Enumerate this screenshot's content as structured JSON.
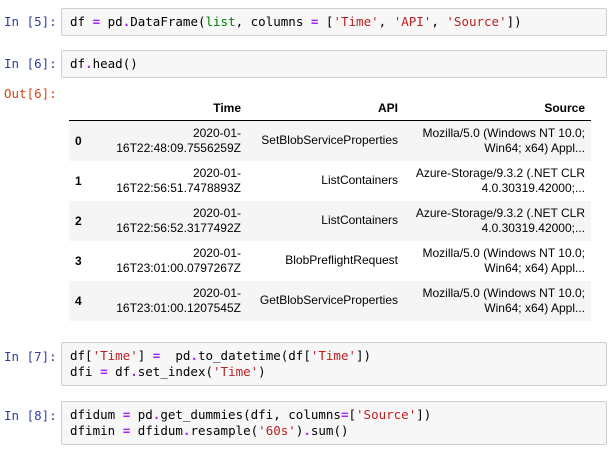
{
  "cells": [
    {
      "prompt": "In [5]:",
      "lines": [
        [
          {
            "t": "df",
            "c": "var"
          },
          {
            "t": " ",
            "c": "var"
          },
          {
            "t": "=",
            "c": "op"
          },
          {
            "t": " pd",
            "c": "var"
          },
          {
            "t": ".",
            "c": "op"
          },
          {
            "t": "DataFrame(",
            "c": "var"
          },
          {
            "t": "list",
            "c": "builtin"
          },
          {
            "t": ", columns ",
            "c": "var"
          },
          {
            "t": "=",
            "c": "op"
          },
          {
            "t": " [",
            "c": "var"
          },
          {
            "t": "'Time'",
            "c": "str"
          },
          {
            "t": ", ",
            "c": "var"
          },
          {
            "t": "'API'",
            "c": "str"
          },
          {
            "t": ", ",
            "c": "var"
          },
          {
            "t": "'Source'",
            "c": "str"
          },
          {
            "t": "])",
            "c": "var"
          }
        ]
      ]
    },
    {
      "prompt": "In [6]:",
      "lines": [
        [
          {
            "t": "df",
            "c": "var"
          },
          {
            "t": ".",
            "c": "op"
          },
          {
            "t": "head()",
            "c": "var"
          }
        ]
      ]
    },
    {
      "prompt": "In [7]:",
      "lines": [
        [
          {
            "t": "df[",
            "c": "var"
          },
          {
            "t": "'Time'",
            "c": "str"
          },
          {
            "t": "] ",
            "c": "var"
          },
          {
            "t": "=",
            "c": "op"
          },
          {
            "t": "  pd",
            "c": "var"
          },
          {
            "t": ".",
            "c": "op"
          },
          {
            "t": "to_datetime(df[",
            "c": "var"
          },
          {
            "t": "'Time'",
            "c": "str"
          },
          {
            "t": "])",
            "c": "var"
          }
        ],
        [
          {
            "t": "dfi ",
            "c": "var"
          },
          {
            "t": "=",
            "c": "op"
          },
          {
            "t": " df",
            "c": "var"
          },
          {
            "t": ".",
            "c": "op"
          },
          {
            "t": "set_index(",
            "c": "var"
          },
          {
            "t": "'Time'",
            "c": "str"
          },
          {
            "t": ")",
            "c": "var"
          }
        ]
      ]
    },
    {
      "prompt": "In [8]:",
      "lines": [
        [
          {
            "t": "dfidum ",
            "c": "var"
          },
          {
            "t": "=",
            "c": "op"
          },
          {
            "t": " pd",
            "c": "var"
          },
          {
            "t": ".",
            "c": "op"
          },
          {
            "t": "get_dummies(dfi, columns",
            "c": "var"
          },
          {
            "t": "=",
            "c": "op"
          },
          {
            "t": "[",
            "c": "var"
          },
          {
            "t": "'Source'",
            "c": "str"
          },
          {
            "t": "])",
            "c": "var"
          }
        ],
        [
          {
            "t": "dfimin ",
            "c": "var"
          },
          {
            "t": "=",
            "c": "op"
          },
          {
            "t": " dfidum",
            "c": "var"
          },
          {
            "t": ".",
            "c": "op"
          },
          {
            "t": "resample(",
            "c": "var"
          },
          {
            "t": "'60s'",
            "c": "str"
          },
          {
            "t": ")",
            "c": "var"
          },
          {
            "t": ".",
            "c": "op"
          },
          {
            "t": "sum()",
            "c": "var"
          }
        ]
      ]
    }
  ],
  "output_prompt": "Out[6]:",
  "table": {
    "columns": [
      "Time",
      "API",
      "Source"
    ],
    "rows": [
      {
        "index": "0",
        "time": [
          "2020-01-",
          "16T22:48:09.7556259Z"
        ],
        "api": "SetBlobServiceProperties",
        "source": [
          "Mozilla/5.0 (Windows NT 10.0;",
          "Win64; x64) Appl..."
        ]
      },
      {
        "index": "1",
        "time": [
          "2020-01-",
          "16T22:56:51.7478893Z"
        ],
        "api": "ListContainers",
        "source": [
          "Azure-Storage/9.3.2 (.NET CLR",
          "4.0.30319.42000;..."
        ]
      },
      {
        "index": "2",
        "time": [
          "2020-01-",
          "16T22:56:52.3177492Z"
        ],
        "api": "ListContainers",
        "source": [
          "Azure-Storage/9.3.2 (.NET CLR",
          "4.0.30319.42000;..."
        ]
      },
      {
        "index": "3",
        "time": [
          "2020-01-",
          "16T23:01:00.0797267Z"
        ],
        "api": "BlobPreflightRequest",
        "source": [
          "Mozilla/5.0 (Windows NT 10.0;",
          "Win64; x64) Appl..."
        ]
      },
      {
        "index": "4",
        "time": [
          "2020-01-",
          "16T23:01:00.1207545Z"
        ],
        "api": "GetBlobServiceProperties",
        "source": [
          "Mozilla/5.0 (Windows NT 10.0;",
          "Win64; x64) Appl..."
        ]
      }
    ]
  },
  "colors": {
    "in_prompt": "#303f9f",
    "out_prompt": "#d84315",
    "string": "#ba2121",
    "operator": "#aa22ff",
    "builtin": "#008000"
  }
}
